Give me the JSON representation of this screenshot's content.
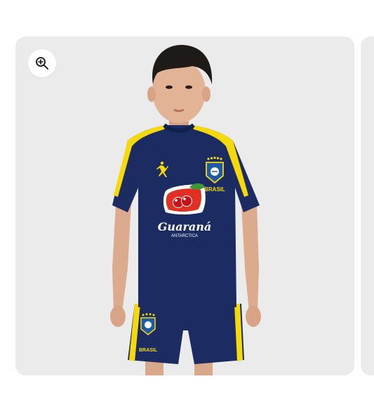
{
  "gallery": {
    "zoom_icon": "zoom-in-magnifier-icon",
    "card_color": "#ebebeb"
  },
  "product_image": {
    "sponsor_name": "Guaraná",
    "sponsor_sub": "ANTARCTICA",
    "crest_label_shirt": "BRASIL",
    "crest_label_shorts": "BRASIL",
    "kit_color": "#1c2c63",
    "trim_color": "#f5d90a"
  }
}
